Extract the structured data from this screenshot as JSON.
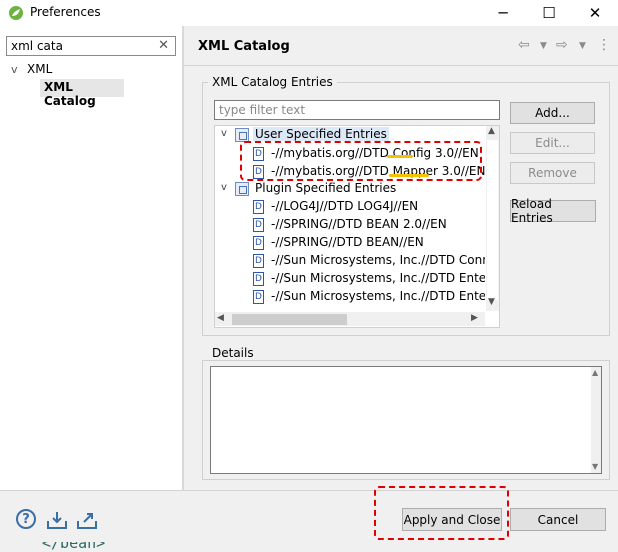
{
  "window": {
    "title": "Preferences",
    "minimize": "─",
    "maximize": "☐",
    "close": "✕"
  },
  "left": {
    "filter_value": "xml cata",
    "clear": "✕",
    "tree": {
      "xml": "XML",
      "xml_catalog": "XML Catalog"
    }
  },
  "page": {
    "title": "XML Catalog",
    "nav_back": "⇦",
    "nav_forward": "⇨",
    "menu": "⋮"
  },
  "entries": {
    "legend": "XML Catalog Entries",
    "filter_placeholder": "type filter text",
    "user_group": "User Specified Entries",
    "user_items": [
      "-//mybatis.org//DTD Config 3.0//EN",
      "-//mybatis.org//DTD Mapper 3.0//EN"
    ],
    "plugin_group": "Plugin Specified Entries",
    "plugin_items": [
      "-//LOG4J//DTD LOG4J//EN",
      "-//SPRING//DTD BEAN 2.0//EN",
      "-//SPRING//DTD BEAN//EN",
      "-//Sun Microsystems, Inc.//DTD Conne",
      "-//Sun Microsystems, Inc.//DTD Enterpr",
      "-//Sun Microsystems, Inc.//DTD Enterpr"
    ],
    "buttons": {
      "add": "Add...",
      "edit": "Edit...",
      "remove": "Remove",
      "reload": "Reload Entries"
    }
  },
  "details": {
    "legend": "Details"
  },
  "bottom": {
    "help": "?",
    "apply_close": "Apply and Close",
    "cancel": "Cancel",
    "background_code": "</bean>"
  },
  "colors": {
    "accent_red": "#e00000",
    "selection": "#dde8f7",
    "icon_blue": "#2d55a8"
  }
}
